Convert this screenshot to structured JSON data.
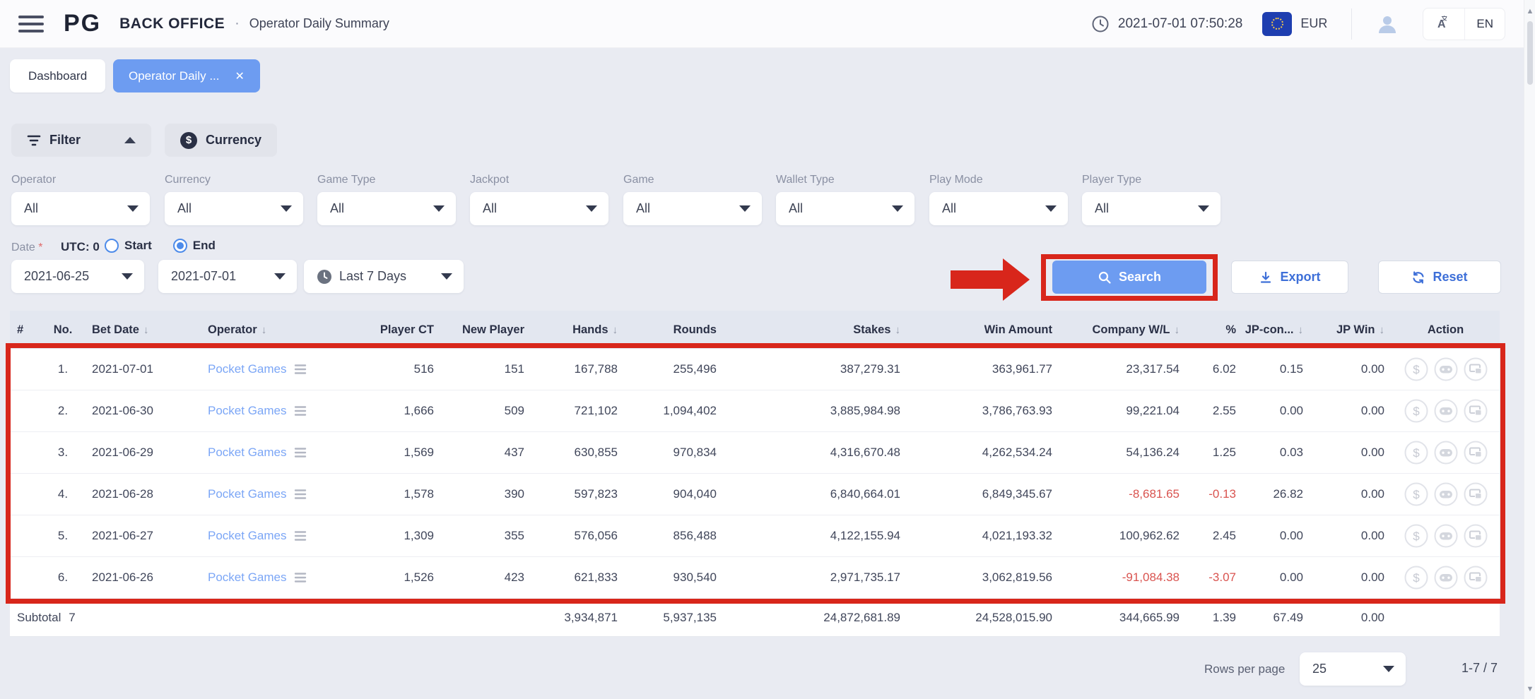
{
  "topbar": {
    "logo_text": "PG",
    "brand": "BACK OFFICE",
    "separator": "·",
    "page_title": "Operator Daily Summary",
    "datetime": "2021-07-01 07:50:28",
    "currency_code": "EUR",
    "language_code": "EN"
  },
  "tabs": [
    {
      "label": "Dashboard",
      "active": false,
      "closable": false
    },
    {
      "label": "Operator Daily ...",
      "active": true,
      "closable": true
    }
  ],
  "filter_panel": {
    "filter_toggle_label": "Filter",
    "currency_toggle_label": "Currency",
    "fields": [
      {
        "label": "Operator",
        "value": "All"
      },
      {
        "label": "Currency",
        "value": "All"
      },
      {
        "label": "Game Type",
        "value": "All"
      },
      {
        "label": "Jackpot",
        "value": "All"
      },
      {
        "label": "Game",
        "value": "All"
      },
      {
        "label": "Wallet Type",
        "value": "All"
      },
      {
        "label": "Play Mode",
        "value": "All"
      },
      {
        "label": "Player Type",
        "value": "All"
      }
    ],
    "date": {
      "label": "Date",
      "required_mark": "*",
      "utc_label": "UTC: 0",
      "radio_options": [
        {
          "label": "Start",
          "selected": false
        },
        {
          "label": "End",
          "selected": true
        }
      ],
      "start_date": "2021-06-25",
      "end_date": "2021-07-01",
      "preset": "Last 7 Days"
    },
    "buttons": {
      "search": "Search",
      "export": "Export",
      "reset": "Reset"
    }
  },
  "table": {
    "columns": [
      {
        "key": "idx",
        "label": "#",
        "sorted": false
      },
      {
        "key": "no",
        "label": "No.",
        "sorted": false
      },
      {
        "key": "bet_date",
        "label": "Bet Date",
        "sorted": true
      },
      {
        "key": "operator",
        "label": "Operator",
        "sorted": true
      },
      {
        "key": "player_ct",
        "label": "Player CT",
        "sorted": false
      },
      {
        "key": "new_player",
        "label": "New Player",
        "sorted": false
      },
      {
        "key": "hands",
        "label": "Hands",
        "sorted": true
      },
      {
        "key": "rounds",
        "label": "Rounds",
        "sorted": false
      },
      {
        "key": "stakes",
        "label": "Stakes",
        "sorted": true
      },
      {
        "key": "win_amount",
        "label": "Win Amount",
        "sorted": false
      },
      {
        "key": "company_wl",
        "label": "Company W/L",
        "sorted": true
      },
      {
        "key": "pct",
        "label": "%",
        "sorted": false
      },
      {
        "key": "jp_con",
        "label": "JP-con...",
        "sorted": true
      },
      {
        "key": "jp_win",
        "label": "JP Win",
        "sorted": true
      },
      {
        "key": "action",
        "label": "Action",
        "sorted": false
      }
    ],
    "rows": [
      {
        "no": "1.",
        "bet_date": "2021-07-01",
        "operator": "Pocket Games",
        "player_ct": "516",
        "new_player": "151",
        "hands": "167,788",
        "rounds": "255,496",
        "stakes": "387,279.31",
        "win_amount": "363,961.77",
        "company_wl": "23,317.54",
        "pct": "6.02",
        "jp_con": "0.15",
        "jp_win": "0.00"
      },
      {
        "no": "2.",
        "bet_date": "2021-06-30",
        "operator": "Pocket Games",
        "player_ct": "1,666",
        "new_player": "509",
        "hands": "721,102",
        "rounds": "1,094,402",
        "stakes": "3,885,984.98",
        "win_amount": "3,786,763.93",
        "company_wl": "99,221.04",
        "pct": "2.55",
        "jp_con": "0.00",
        "jp_win": "0.00"
      },
      {
        "no": "3.",
        "bet_date": "2021-06-29",
        "operator": "Pocket Games",
        "player_ct": "1,569",
        "new_player": "437",
        "hands": "630,855",
        "rounds": "970,834",
        "stakes": "4,316,670.48",
        "win_amount": "4,262,534.24",
        "company_wl": "54,136.24",
        "pct": "1.25",
        "jp_con": "0.03",
        "jp_win": "0.00"
      },
      {
        "no": "4.",
        "bet_date": "2021-06-28",
        "operator": "Pocket Games",
        "player_ct": "1,578",
        "new_player": "390",
        "hands": "597,823",
        "rounds": "904,040",
        "stakes": "6,840,664.01",
        "win_amount": "6,849,345.67",
        "company_wl": "-8,681.65",
        "pct": "-0.13",
        "jp_con": "26.82",
        "jp_win": "0.00"
      },
      {
        "no": "5.",
        "bet_date": "2021-06-27",
        "operator": "Pocket Games",
        "player_ct": "1,309",
        "new_player": "355",
        "hands": "576,056",
        "rounds": "856,488",
        "stakes": "4,122,155.94",
        "win_amount": "4,021,193.32",
        "company_wl": "100,962.62",
        "pct": "2.45",
        "jp_con": "0.00",
        "jp_win": "0.00"
      },
      {
        "no": "6.",
        "bet_date": "2021-06-26",
        "operator": "Pocket Games",
        "player_ct": "1,526",
        "new_player": "423",
        "hands": "621,833",
        "rounds": "930,540",
        "stakes": "2,971,735.17",
        "win_amount": "3,062,819.56",
        "company_wl": "-91,084.38",
        "pct": "-3.07",
        "jp_con": "0.00",
        "jp_win": "0.00"
      }
    ],
    "subtotal": {
      "label": "Subtotal",
      "no": "7",
      "hands": "3,934,871",
      "rounds": "5,937,135",
      "stakes": "24,872,681.89",
      "win_amount": "24,528,015.90",
      "company_wl": "344,665.99",
      "pct": "1.39",
      "jp_con": "67.49",
      "jp_win": "0.00"
    },
    "action_icons": [
      "dollar-icon",
      "gamepad-icon",
      "devices-icon"
    ]
  },
  "pagination": {
    "rows_per_page_label": "Rows per page",
    "rows_per_page": "25",
    "range": "1-7 / 7"
  },
  "annotation": {
    "color": "#D8261B"
  },
  "colors": {
    "accent_blue": "#6D9CF1",
    "link_blue": "#7BA6F6",
    "negative_red": "#D9534F",
    "page_bg": "#E9EBF2"
  }
}
